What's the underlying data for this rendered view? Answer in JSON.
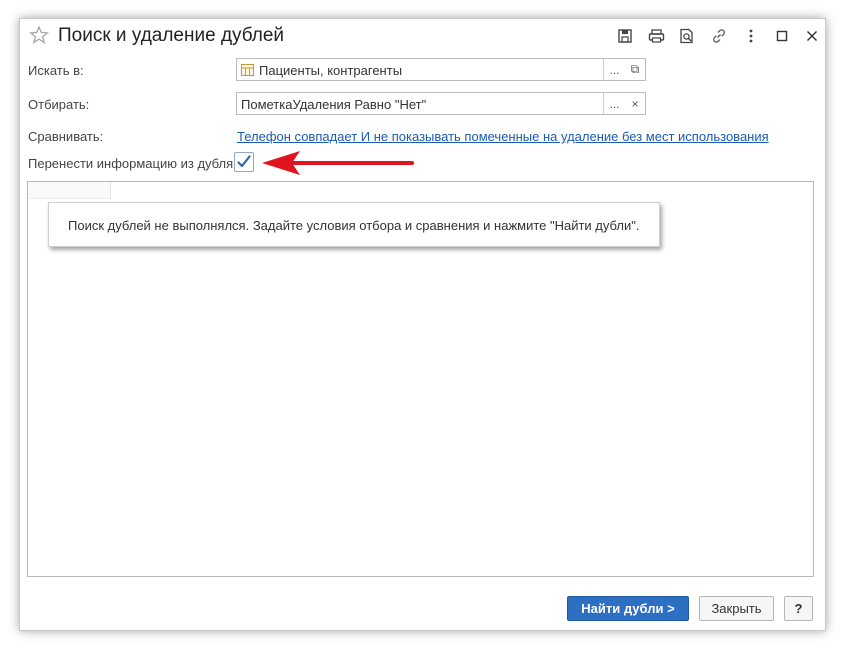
{
  "window": {
    "title": "Поиск и удаление дублей"
  },
  "toolbar": {
    "icons": [
      "save-icon",
      "print-icon",
      "preview-icon",
      "link-icon",
      "more-icon",
      "maximize-icon",
      "close-icon"
    ]
  },
  "form": {
    "search_in": {
      "label": "Искать в:",
      "value": "Пациенты, контрагенты",
      "select_label": "...",
      "open_label": "⧉"
    },
    "filter": {
      "label": "Отбирать:",
      "value": "ПометкаУдаления Равно \"Нет\"",
      "select_label": "...",
      "clear_label": "×"
    },
    "compare": {
      "label": "Сравнивать:",
      "link": "Телефон совпадает И не показывать помеченные на удаление без мест использования"
    },
    "transfer": {
      "label": "Перенести информацию из дубля:",
      "checked": true
    }
  },
  "results": {
    "message": "Поиск дублей не выполнялся.  Задайте условия отбора и сравнения и нажмите \"Найти дубли\"."
  },
  "buttons": {
    "find": "Найти дубли >",
    "close": "Закрыть",
    "help": "?"
  },
  "colors": {
    "accent": "#2d6fc2",
    "link": "#1a5bb5",
    "annotation_arrow": "#e0141e",
    "check": "#2a64b4"
  }
}
